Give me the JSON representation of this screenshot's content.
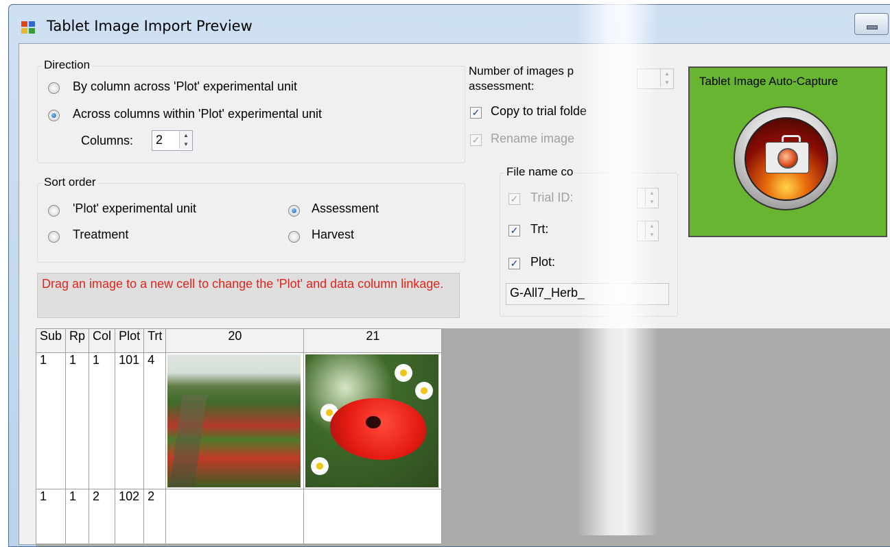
{
  "window": {
    "title": "Tablet Image Import Preview"
  },
  "direction": {
    "legend": "Direction",
    "options": [
      {
        "label": "By column across 'Plot' experimental unit",
        "checked": false
      },
      {
        "label": "Across columns within 'Plot' experimental unit",
        "checked": true
      }
    ],
    "columns_label": "Columns:",
    "columns_value": "2"
  },
  "sort_order": {
    "legend": "Sort order",
    "options": [
      {
        "label": "'Plot' experimental unit",
        "checked": false
      },
      {
        "label": "Assessment",
        "checked": true
      },
      {
        "label": "Treatment",
        "checked": false
      },
      {
        "label": "Harvest",
        "checked": false
      }
    ]
  },
  "settings": {
    "num_images_label_1": "Number of images p",
    "num_images_label_2": "assessment:",
    "copy_label": "Copy to trial folde",
    "copy_checked": true,
    "rename_label": "Rename image",
    "rename_checked": true
  },
  "file_name": {
    "legend": "File name co",
    "trial_id_label": "Trial ID:",
    "trt_label": "Trt:",
    "plot_label": "Plot:",
    "name_value": "G-All7_Herb_"
  },
  "hint_text": "Drag an image to a new cell to change the 'Plot' and data column linkage.",
  "capture_button_label": "Tablet Image Auto-Capture",
  "grid": {
    "headers": [
      "Sub",
      "Rp",
      "Col",
      "Plot",
      "Trt",
      "20",
      "21"
    ],
    "rows": [
      [
        "1",
        "1",
        "1",
        "101",
        "4"
      ],
      [
        "1",
        "1",
        "2",
        "102",
        "2"
      ]
    ]
  }
}
